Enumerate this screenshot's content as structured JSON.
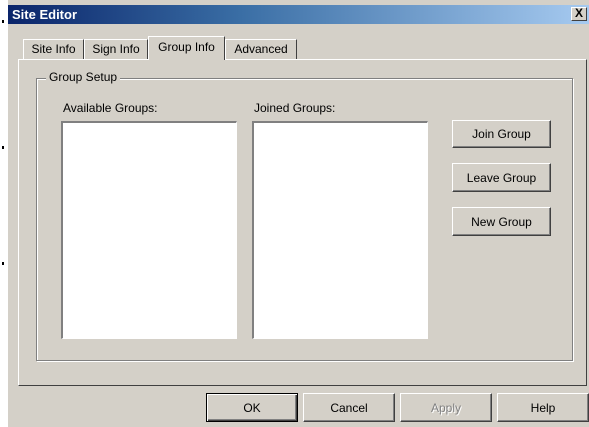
{
  "window": {
    "title": "Site Editor",
    "close_label": "X"
  },
  "tabs": [
    {
      "label": "Site Info",
      "active": false
    },
    {
      "label": "Sign Info",
      "active": false
    },
    {
      "label": "Group Info",
      "active": true
    },
    {
      "label": "Advanced",
      "active": false
    }
  ],
  "group_setup": {
    "legend": "Group Setup",
    "available_label": "Available Groups:",
    "joined_label": "Joined Groups:",
    "available_items": [],
    "joined_items": [],
    "buttons": {
      "join": "Join Group",
      "leave": "Leave Group",
      "new": "New Group"
    }
  },
  "footer": {
    "ok": "OK",
    "cancel": "Cancel",
    "apply": "Apply",
    "help": "Help",
    "apply_disabled": true
  },
  "colors": {
    "face": "#d4d0c8",
    "titlebar_start": "#0a246a",
    "titlebar_end": "#a6caf0"
  }
}
